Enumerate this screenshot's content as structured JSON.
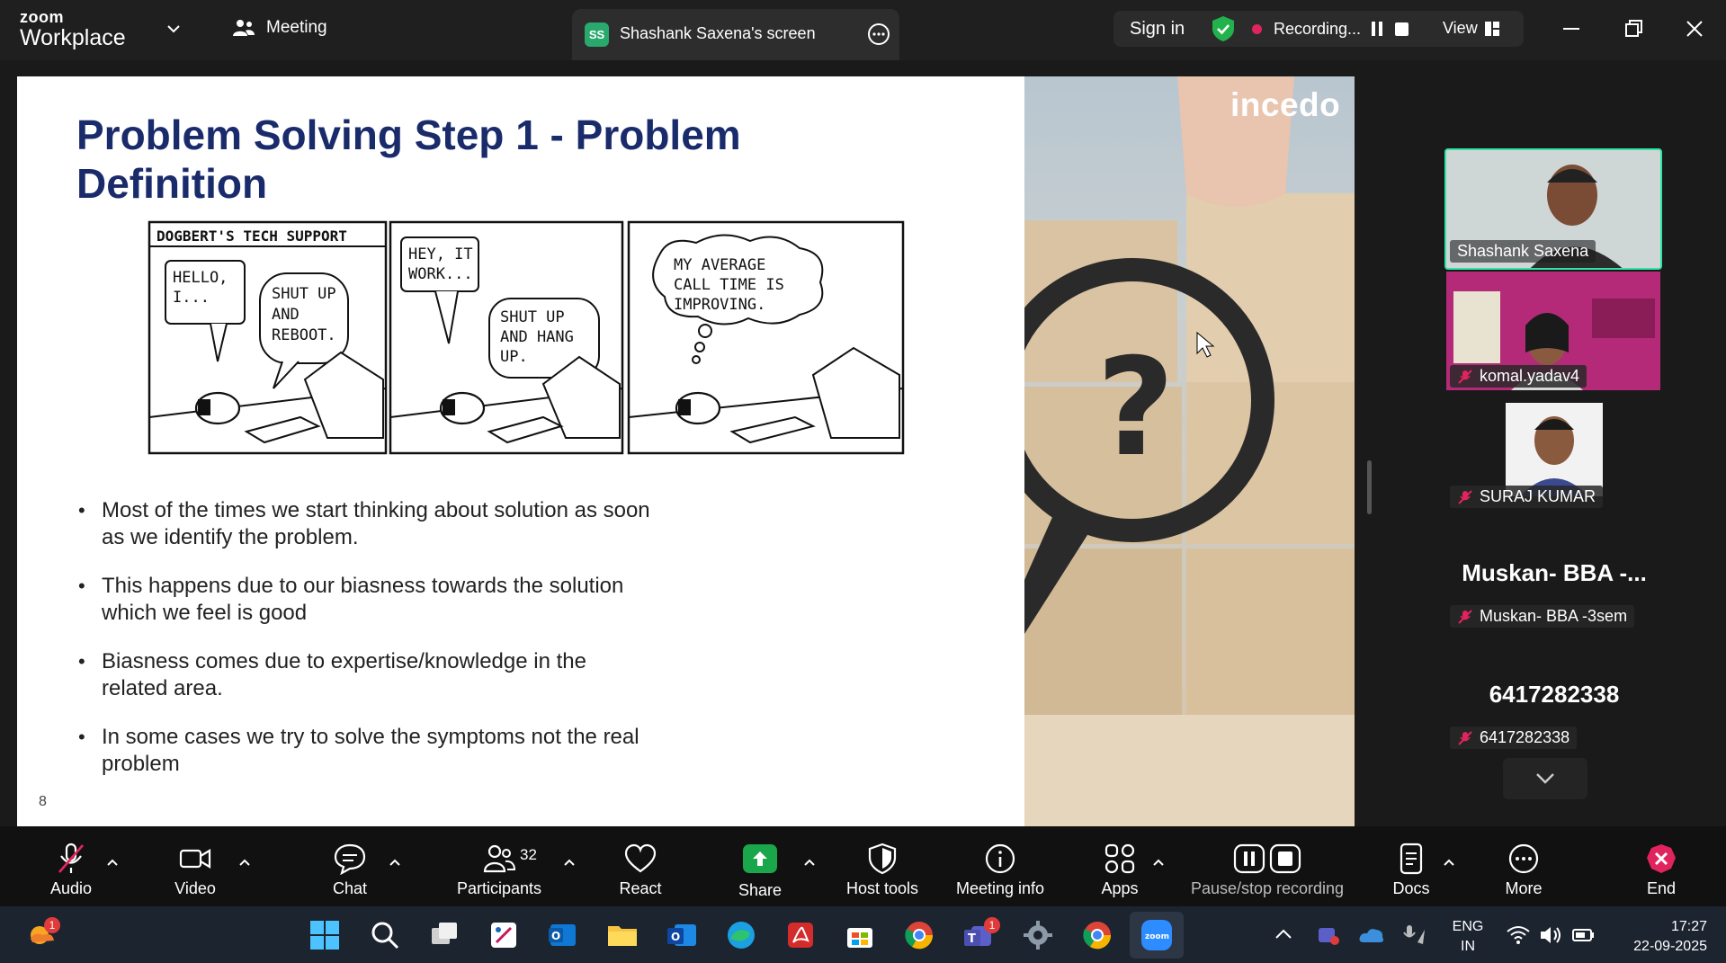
{
  "titlebar": {
    "brand_small": "zoom",
    "brand_large": "Workplace",
    "meeting_label": "Meeting",
    "screen_badge": "SS",
    "screen_tab_label": "Shashank Saxena's screen",
    "sign_in": "Sign in",
    "recording_label": "Recording...",
    "view_label": "View"
  },
  "slide": {
    "title": "Problem Solving Step 1 - Problem Definition",
    "comic": {
      "header": "DOGBERT'S TECH SUPPORT",
      "panel1_left": [
        "HELLO,",
        "I..."
      ],
      "panel1_right": [
        "SHUT UP",
        "AND",
        "REBOOT."
      ],
      "panel2_top": [
        "HEY, IT",
        "WORK..."
      ],
      "panel2_bottom": [
        "SHUT UP",
        "AND HANG",
        "UP."
      ],
      "panel3_thought": [
        "MY AVERAGE",
        "CALL TIME IS",
        "IMPROVING."
      ]
    },
    "bullets": [
      "Most of the times we start thinking about solution as soon as we identify the problem.",
      "This happens due to our biasness towards the solution which we feel is good",
      "Biasness comes due to expertise/knowledge in the related area.",
      "In some cases we try to solve the symptoms not the real problem"
    ],
    "page_number": "8",
    "brand_logo": "incedo",
    "photo_symbol": "?"
  },
  "participants": {
    "tile1_name": "Shashank Saxena",
    "tile2_name": "komal.yadav4",
    "tile3_name": "SURAJ KUMAR",
    "tile4_big": "Muskan- BBA -...",
    "tile4_name": "Muskan- BBA -3sem",
    "tile5_big": "6417282338",
    "tile5_name": "6417282338"
  },
  "toolbar": {
    "audio": "Audio",
    "video": "Video",
    "chat": "Chat",
    "participants": "Participants",
    "participants_count": "32",
    "react": "React",
    "share": "Share",
    "host_tools": "Host tools",
    "meeting_info": "Meeting info",
    "apps": "Apps",
    "pause_stop": "Pause/stop recording",
    "docs": "Docs",
    "more": "More",
    "end": "End"
  },
  "taskbar": {
    "weather_badge": "1",
    "teams_badge": "1",
    "lang_top": "ENG",
    "lang_bottom": "IN",
    "time": "17:27",
    "date": "22-09-2025"
  },
  "colors": {
    "title_blue": "#1a2b6b",
    "share_green": "#1aa64a",
    "active_border": "#2ee6a6",
    "recording_dot": "#e0245e",
    "end_red": "#e0245e"
  }
}
